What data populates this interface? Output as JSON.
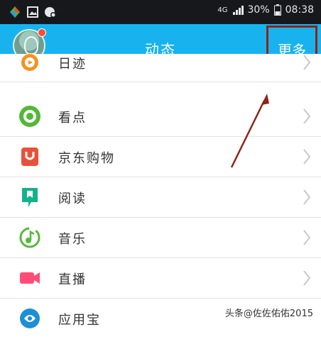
{
  "status_bar": {
    "network": "4G",
    "battery": "30%",
    "time": "08:38"
  },
  "header": {
    "title": "动态",
    "more_label": "更多"
  },
  "list": [
    {
      "label": "日迹",
      "icon": "camera-ring-icon",
      "color": "#f7921e"
    },
    {
      "label": "看点",
      "icon": "eye-icon",
      "color": "#53b837"
    },
    {
      "label": "京东购物",
      "icon": "jd-shopping-bag-icon",
      "color": "#e8513a"
    },
    {
      "label": "阅读",
      "icon": "book-bookmark-icon",
      "color": "#12b28c"
    },
    {
      "label": "音乐",
      "icon": "music-note-icon",
      "color": "#59b83c"
    },
    {
      "label": "直播",
      "icon": "video-camera-icon",
      "color": "#ff4d78"
    },
    {
      "label": "应用宝",
      "icon": "app-store-icon",
      "color": "#1c8fd6"
    }
  ],
  "watermark": "头条@佐佐佑佑2015",
  "colors": {
    "header_bg": "#18b3ee",
    "status_bg": "#17181c",
    "annotation": "#8f2315"
  }
}
